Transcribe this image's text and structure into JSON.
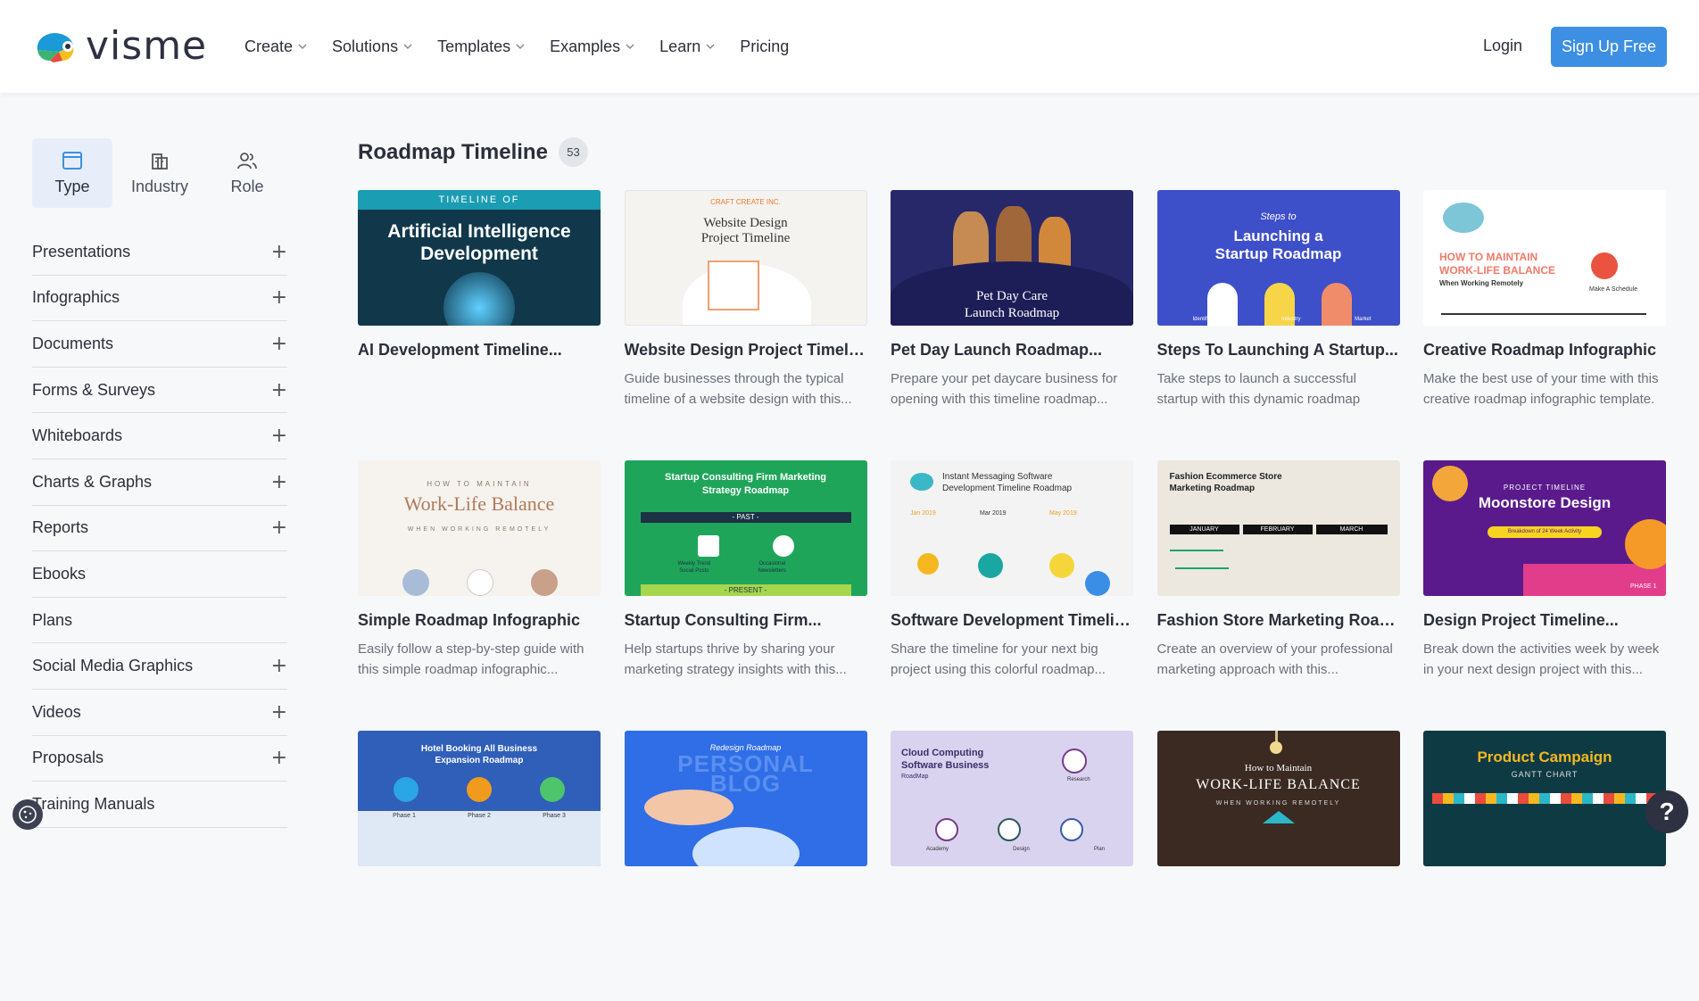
{
  "brand": {
    "name": "visme",
    "accent": "#3c8fe3"
  },
  "nav": {
    "items": [
      {
        "label": "Create",
        "has_dropdown": true
      },
      {
        "label": "Solutions",
        "has_dropdown": true
      },
      {
        "label": "Templates",
        "has_dropdown": true
      },
      {
        "label": "Examples",
        "has_dropdown": true
      },
      {
        "label": "Learn",
        "has_dropdown": true
      },
      {
        "label": "Pricing",
        "has_dropdown": false
      }
    ],
    "login": "Login",
    "signup": "Sign Up Free"
  },
  "filter_tabs": [
    {
      "label": "Type",
      "icon": "window-icon",
      "active": true
    },
    {
      "label": "Industry",
      "icon": "buildings-icon",
      "active": false
    },
    {
      "label": "Role",
      "icon": "users-icon",
      "active": false
    }
  ],
  "categories": [
    {
      "label": "Presentations",
      "expandable": true
    },
    {
      "label": "Infographics",
      "expandable": true
    },
    {
      "label": "Documents",
      "expandable": true
    },
    {
      "label": "Forms & Surveys",
      "expandable": true
    },
    {
      "label": "Whiteboards",
      "expandable": true
    },
    {
      "label": "Charts & Graphs",
      "expandable": true
    },
    {
      "label": "Reports",
      "expandable": true
    },
    {
      "label": "Ebooks",
      "expandable": false
    },
    {
      "label": "Plans",
      "expandable": false
    },
    {
      "label": "Social Media Graphics",
      "expandable": true
    },
    {
      "label": "Videos",
      "expandable": true
    },
    {
      "label": "Proposals",
      "expandable": true
    },
    {
      "label": "Training Manuals",
      "expandable": false
    }
  ],
  "main": {
    "title": "Roadmap Timeline",
    "count": "53"
  },
  "templates": [
    {
      "title": "AI Development Timeline...",
      "desc": "",
      "thumb_text": [
        "TIMELINE OF",
        "Artificial Intelligence",
        "Development"
      ],
      "bg": "#10384a"
    },
    {
      "title": "Website Design Project Timeline...",
      "desc": "Guide businesses through the typical timeline of a website design with this...",
      "thumb_text": [
        "CRAFT CREATE INC.",
        "Website Design",
        "Project Timeline"
      ],
      "bg": "#f5f3f0"
    },
    {
      "title": "Pet Day Launch Roadmap...",
      "desc": "Prepare your pet daycare business for opening with this timeline roadmap...",
      "thumb_text": [
        "Pet Day Care",
        "Launch Roadmap"
      ],
      "bg": "#27286a"
    },
    {
      "title": "Steps To Launching A Startup...",
      "desc": "Take steps to launch a successful startup with this dynamic roadmap infographic...",
      "thumb_text": [
        "Steps to",
        "Launching a",
        "Startup Roadmap",
        "Identify a Core",
        "Industry",
        "Market"
      ],
      "bg": "#3d4fc9"
    },
    {
      "title": "Creative Roadmap Infographic",
      "desc": "Make the best use of your time with this creative roadmap infographic template.",
      "thumb_text": [
        "HOW TO MAINTAIN",
        "WORK-LIFE BALANCE",
        "When Working Remotely",
        "Make A Schedule"
      ],
      "bg": "#ffffff"
    },
    {
      "title": "Simple Roadmap Infographic",
      "desc": "Easily follow a step-by-step guide with this simple roadmap infographic...",
      "thumb_text": [
        "HOW TO MAINTAIN",
        "Work-Life Balance",
        "WHEN WORKING REMOTELY"
      ],
      "bg": "#f6f3ef"
    },
    {
      "title": "Startup Consulting Firm...",
      "desc": "Help startups thrive by sharing your marketing strategy insights with this...",
      "thumb_text": [
        "Startup Consulting Firm Marketing",
        "Strategy Roadmap",
        "- PAST -",
        "Weekly Trend",
        "Social Posts",
        "Occasional",
        "Newsletters",
        "- PRESENT -"
      ],
      "bg": "#1fa55a"
    },
    {
      "title": "Software Development Timeline...",
      "desc": "Share the timeline for your next big project using this colorful roadmap...",
      "thumb_text": [
        "Instant Messaging Software",
        "Development Timeline Roadmap",
        "Jan 2019",
        "Mar 2019",
        "May 2019"
      ],
      "bg": "#f3f3f3"
    },
    {
      "title": "Fashion Store Marketing Roadm...",
      "desc": "Create an overview of your professional marketing approach with this...",
      "thumb_text": [
        "Fashion Ecommerce Store",
        "Marketing Roadmap",
        "JANUARY",
        "FEBRUARY",
        "MARCH"
      ],
      "bg": "#ece8df"
    },
    {
      "title": "Design Project Timeline...",
      "desc": "Break down the activities week by week in your next design project with this...",
      "thumb_text": [
        "PROJECT TIMELINE",
        "Moonstore Design",
        "Breakdown of 24 Week Activity",
        "PHASE 1"
      ],
      "bg": "#5a1a8c"
    },
    {
      "title": "",
      "desc": "",
      "thumb_text": [
        "Hotel Booking All Business",
        "Expansion Roadmap",
        "Phase 1",
        "Phase 2",
        "Phase 3"
      ],
      "bg": "#2f5fb8"
    },
    {
      "title": "",
      "desc": "",
      "thumb_text": [
        "Redesign Roadmap",
        "PERSONAL",
        "BLOG"
      ],
      "bg": "#2f6ee6"
    },
    {
      "title": "",
      "desc": "",
      "thumb_text": [
        "Cloud Computing",
        "Software Business",
        "RoadMap",
        "Research",
        "Academy",
        "Design",
        "Plan"
      ],
      "bg": "#d9d3ef"
    },
    {
      "title": "",
      "desc": "",
      "thumb_text": [
        "How to Maintain",
        "WORK-LIFE BALANCE",
        "WHEN WORKING REMOTELY"
      ],
      "bg": "#3a2a22"
    },
    {
      "title": "",
      "desc": "",
      "thumb_text": [
        "Product Campaign",
        "GANTT CHART"
      ],
      "bg": "#0e3a44"
    }
  ],
  "help_label": "?"
}
